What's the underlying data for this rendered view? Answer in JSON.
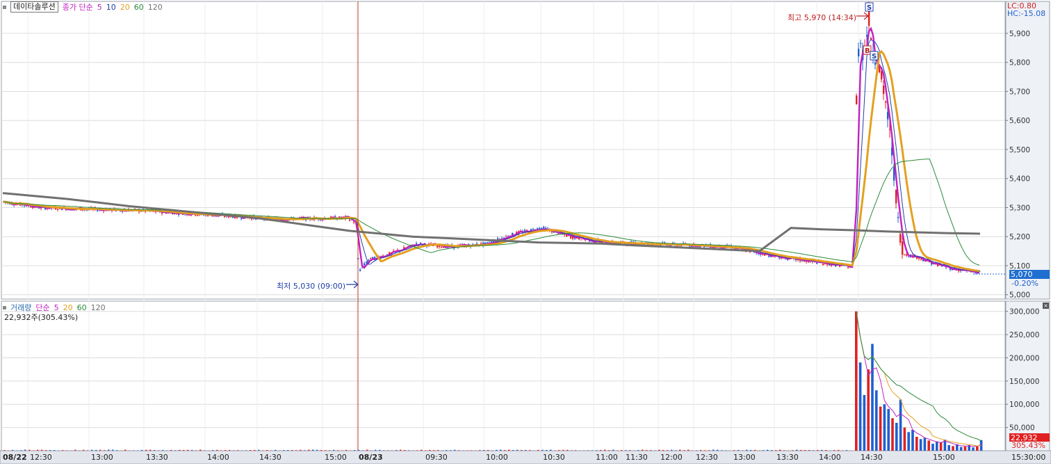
{
  "price_legend": {
    "name": "데이타솔루션",
    "ma_prefix": "종가 단순",
    "ma": [
      {
        "label": "5",
        "color": "#c020c0"
      },
      {
        "label": "10",
        "color": "#1f3fa8"
      },
      {
        "label": "20",
        "color": "#e3a020"
      },
      {
        "label": "60",
        "color": "#2a8a3a"
      },
      {
        "label": "120",
        "color": "#707070"
      }
    ]
  },
  "corner": {
    "lc": "LC:0.80",
    "hc": "HC:-15.08"
  },
  "annotations": {
    "high": "최고 5,970 (14:34)",
    "low": "최저 5,030 (09:00)",
    "marker_s": "S",
    "marker_b": "B",
    "marker_s2": "S"
  },
  "current": {
    "price": "5,070",
    "change": "-0.20%"
  },
  "volume_legend": {
    "name": "거래량",
    "ma_prefix": "단순",
    "ma": [
      {
        "label": "5",
        "color": "#c020c0"
      },
      {
        "label": "20",
        "color": "#e3a020"
      },
      {
        "label": "60",
        "color": "#2a8a3a"
      },
      {
        "label": "120",
        "color": "#707070"
      }
    ],
    "readout": "22,932주(305.43%)"
  },
  "volume_current": {
    "value": "22,932",
    "ratio": "305.43%"
  },
  "colors": {
    "up": "#e02020",
    "down": "#1f5fd0",
    "grid": "#dcdcdc",
    "axis_bg": "#e9ecf2"
  },
  "chart_data": {
    "type": "candlestick",
    "x_ticks": [
      "08/22",
      "12:30",
      "13:00",
      "13:30",
      "14:00",
      "14:30",
      "15:00",
      "08/23",
      "09:30",
      "10:00",
      "10:30",
      "11:00",
      "11:30",
      "12:00",
      "12:30",
      "13:00",
      "13:30",
      "14:00",
      "14:30",
      "15:00",
      "15:30:00"
    ],
    "price": {
      "y_ticks": [
        5000,
        5100,
        5200,
        5300,
        5400,
        5500,
        5600,
        5700,
        5800,
        5900
      ],
      "ylim": [
        4985,
        6010
      ],
      "high": 5970,
      "low": 5030,
      "last": 5070,
      "close_series": [
        5320,
        5310,
        5300,
        5290,
        5285,
        5280,
        5270,
        5265,
        5260,
        5258,
        5250,
        5245,
        5230,
        5030,
        5130,
        5150,
        5170,
        5180,
        5170,
        5180,
        5210,
        5220,
        5225,
        5220,
        5200,
        5180,
        5170,
        5170,
        5165,
        5160,
        5160,
        5150,
        5130,
        5115,
        5110,
        5100,
        5090,
        5080,
        5900,
        5800,
        5600,
        5200,
        5100,
        5120,
        5090,
        5080,
        5075,
        5070
      ],
      "ma120_series": [
        5350,
        5340,
        5330,
        5318,
        5305,
        5295,
        5285,
        5275,
        5265,
        5250,
        5235,
        5220,
        5210,
        5200,
        5195,
        5190,
        5185,
        5180,
        5178,
        5176,
        5170,
        5165,
        5160,
        5155,
        5150,
        5230,
        5225,
        5222,
        5218,
        5215,
        5212,
        5210
      ]
    },
    "volume": {
      "y_ticks": [
        50000,
        100000,
        150000,
        200000,
        250000,
        300000
      ],
      "ylim": [
        0,
        322000
      ],
      "last": 22932,
      "bars_after_1430": [
        300000,
        190000,
        120000,
        175000,
        230000,
        130000,
        95000,
        100000,
        90000,
        70000,
        60000,
        110000,
        50000,
        40000,
        45000,
        30000,
        25000,
        28000,
        22000,
        15000,
        20000,
        18000,
        24000,
        12000,
        10000,
        14000,
        8000,
        9000,
        12000,
        7000,
        10000,
        22932
      ]
    }
  }
}
